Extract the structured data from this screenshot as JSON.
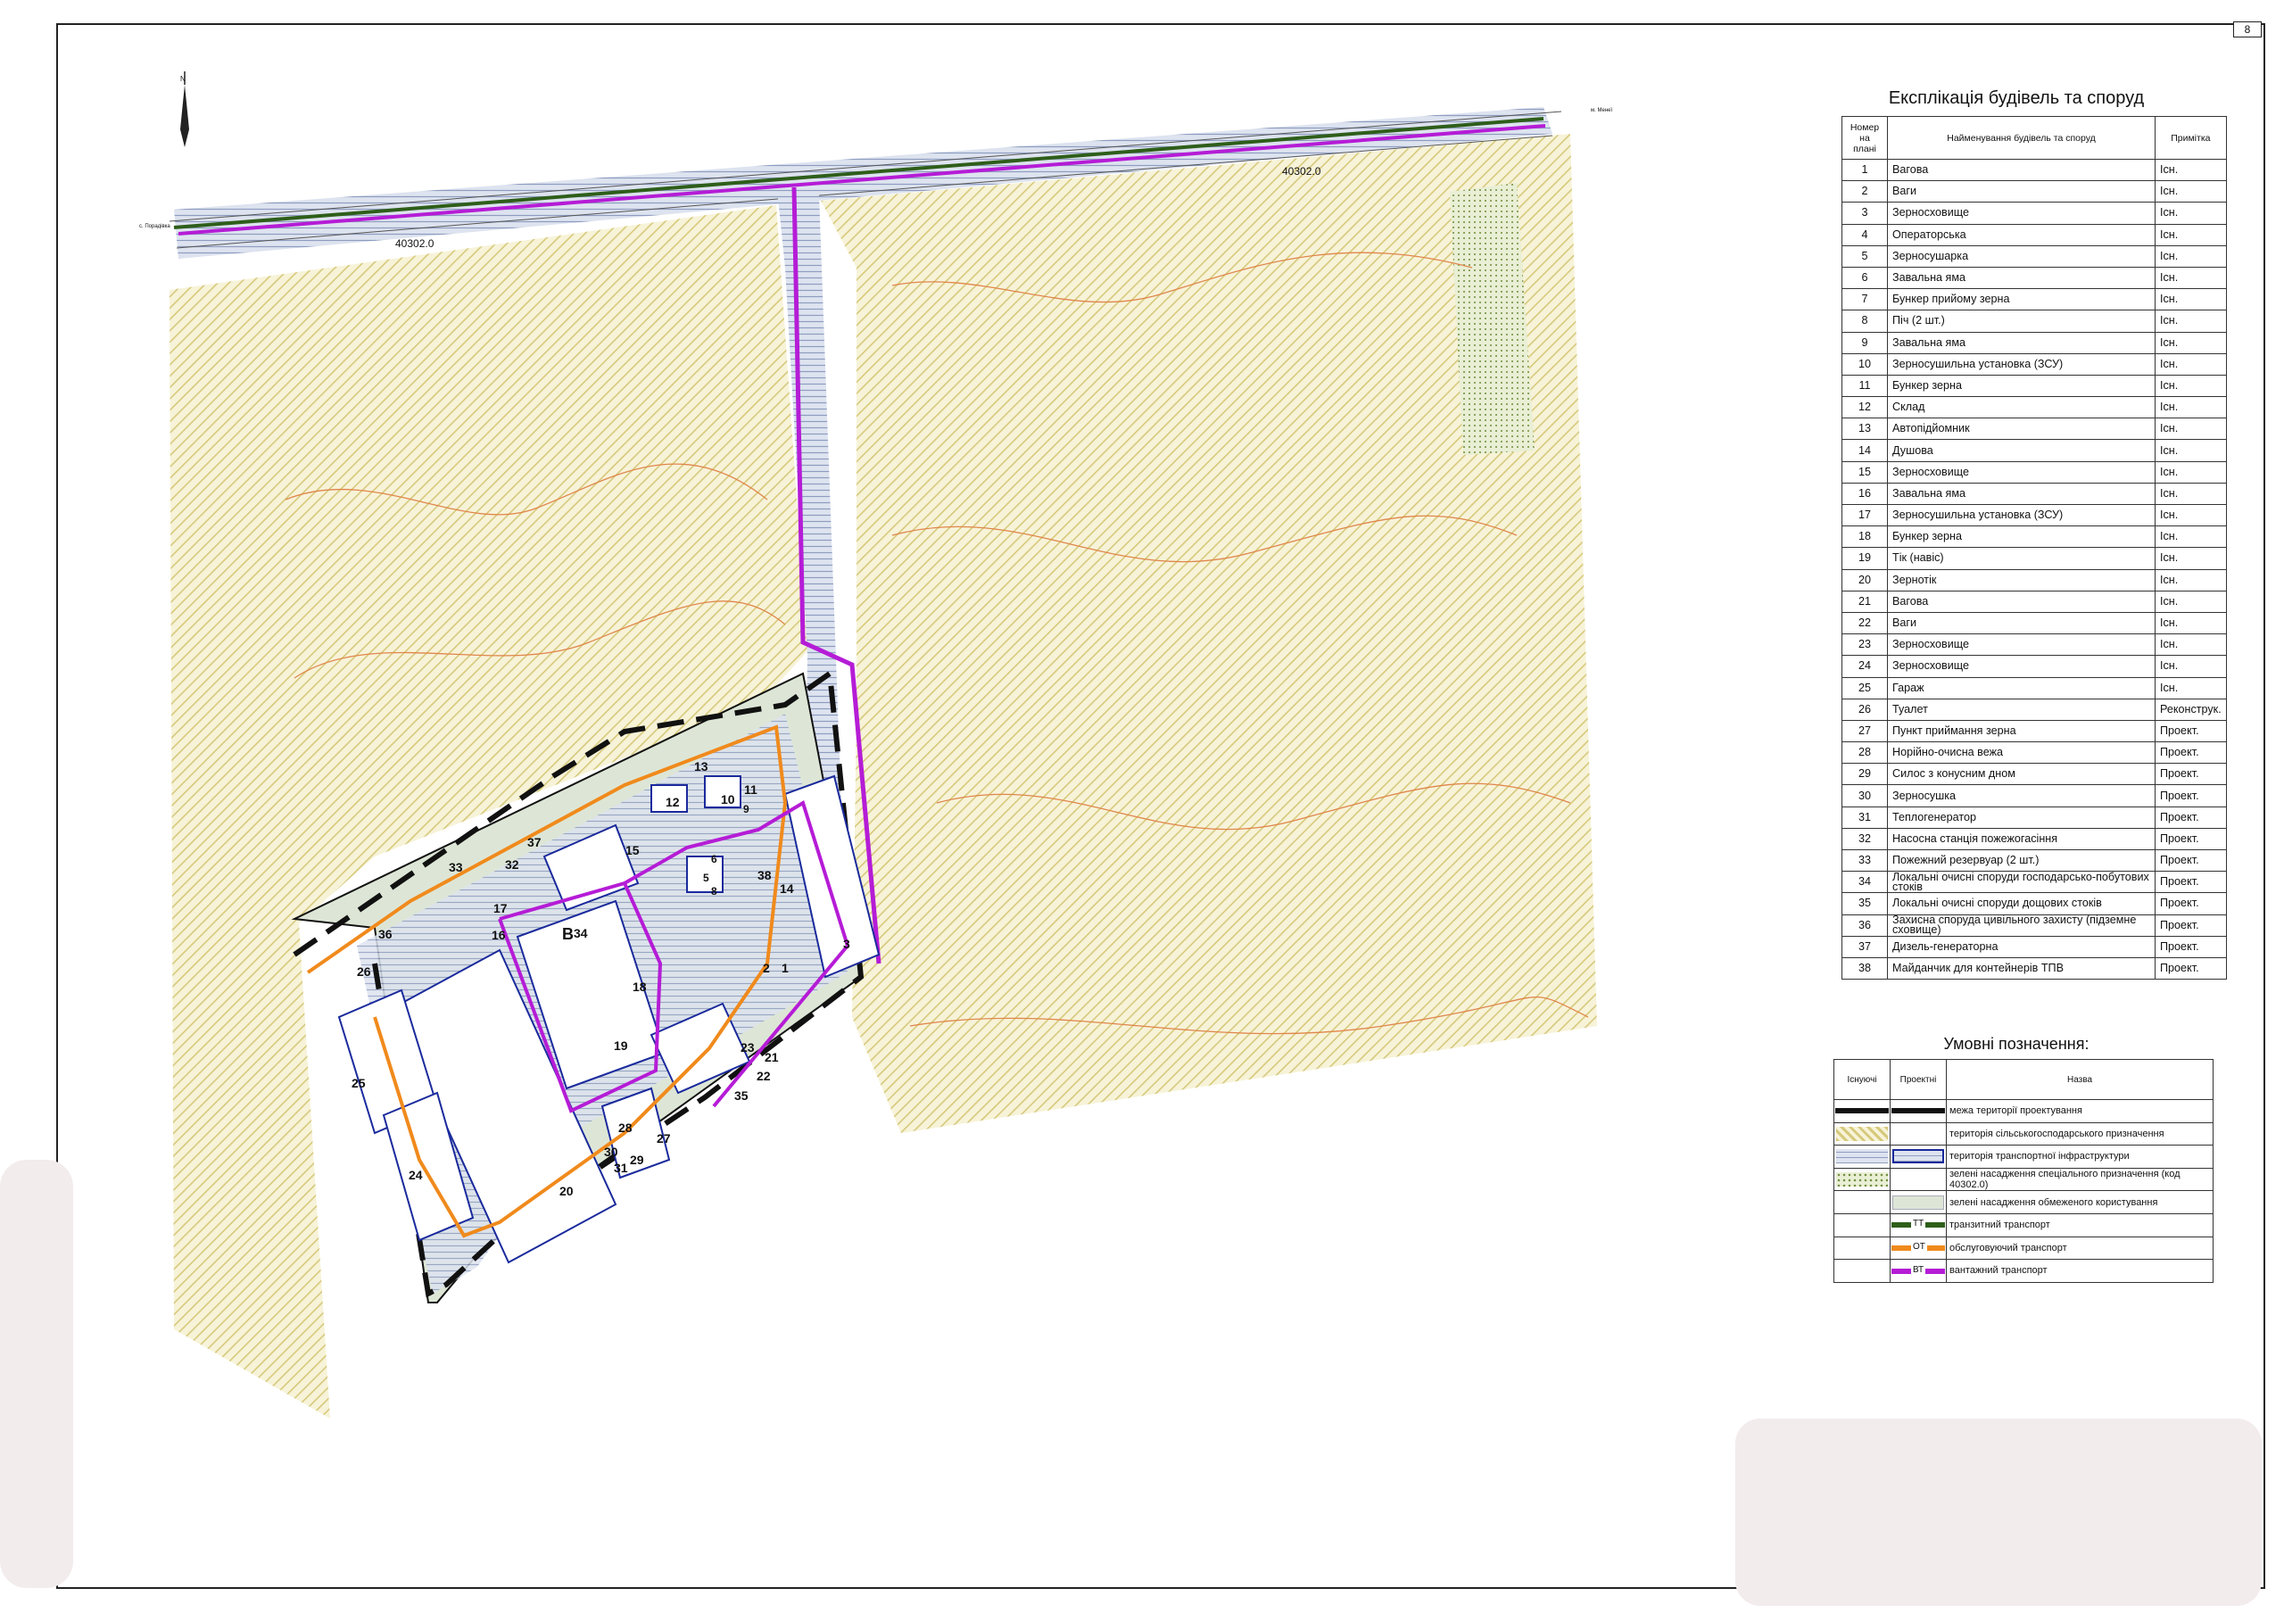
{
  "sheet_number": "8",
  "map": {
    "north_label": "N",
    "code_label_left": "40302.0",
    "code_label_right": "40302.0",
    "road_label_left": "с. Порадівка",
    "road_label_right": "м. Менеї",
    "plan_labels": [
      "1",
      "2",
      "3",
      "5",
      "6",
      "8",
      "9",
      "10",
      "11",
      "12",
      "13",
      "14",
      "15",
      "16",
      "17",
      "18",
      "19",
      "20",
      "21",
      "22",
      "23",
      "24",
      "25",
      "26",
      "27",
      "28",
      "29",
      "30",
      "31",
      "32",
      "33",
      "34",
      "35",
      "36",
      "37",
      "38",
      "B"
    ]
  },
  "explication": {
    "title": "Експлікація будівель та споруд",
    "headers": {
      "num": "Номер на плані",
      "name": "Найменування будівель та споруд",
      "note": "Примітка"
    },
    "rows": [
      {
        "num": "1",
        "name": "Вагова",
        "note": "Існ."
      },
      {
        "num": "2",
        "name": "Ваги",
        "note": "Існ."
      },
      {
        "num": "3",
        "name": "Зерносховище",
        "note": "Існ."
      },
      {
        "num": "4",
        "name": "Операторська",
        "note": "Існ."
      },
      {
        "num": "5",
        "name": "Зерносушарка",
        "note": "Існ."
      },
      {
        "num": "6",
        "name": "Завальна яма",
        "note": "Існ."
      },
      {
        "num": "7",
        "name": "Бункер прийому зерна",
        "note": "Існ."
      },
      {
        "num": "8",
        "name": "Піч (2 шт.)",
        "note": "Існ."
      },
      {
        "num": "9",
        "name": "Завальна яма",
        "note": "Існ."
      },
      {
        "num": "10",
        "name": "Зерносушильна установка (ЗСУ)",
        "note": "Існ."
      },
      {
        "num": "11",
        "name": "Бункер  зерна",
        "note": "Існ."
      },
      {
        "num": "12",
        "name": "Склад",
        "note": "Існ."
      },
      {
        "num": "13",
        "name": "Автопідйомник",
        "note": "Існ."
      },
      {
        "num": "14",
        "name": "Душова",
        "note": "Існ."
      },
      {
        "num": "15",
        "name": "Зерносховище",
        "note": "Існ."
      },
      {
        "num": "16",
        "name": "Завальна яма",
        "note": "Існ."
      },
      {
        "num": "17",
        "name": "Зерносушильна установка (ЗСУ)",
        "note": "Існ."
      },
      {
        "num": "18",
        "name": "Бункер  зерна",
        "note": "Існ."
      },
      {
        "num": "19",
        "name": "Тік (навіс)",
        "note": "Існ."
      },
      {
        "num": "20",
        "name": "Зернотік",
        "note": "Існ."
      },
      {
        "num": "21",
        "name": "Вагова",
        "note": "Існ."
      },
      {
        "num": "22",
        "name": "Ваги",
        "note": "Існ."
      },
      {
        "num": "23",
        "name": "Зерносховище",
        "note": "Існ."
      },
      {
        "num": "24",
        "name": "Зерносховище",
        "note": "Існ."
      },
      {
        "num": "25",
        "name": "Гараж",
        "note": "Існ."
      },
      {
        "num": "26",
        "name": "Туалет",
        "note": "Реконструк."
      },
      {
        "num": "27",
        "name": "Пункт приймання зерна",
        "note": "Проект."
      },
      {
        "num": "28",
        "name": "Норійно-очисна вежа",
        "note": "Проект."
      },
      {
        "num": "29",
        "name": "Силос з конусним дном",
        "note": "Проект."
      },
      {
        "num": "30",
        "name": "Зерносушка",
        "note": "Проект."
      },
      {
        "num": "31",
        "name": "Теплогенератор",
        "note": "Проект."
      },
      {
        "num": "32",
        "name": "Насосна станція пожежогасіння",
        "note": "Проект."
      },
      {
        "num": "33",
        "name": "Пожежний резервуар (2 шт.)",
        "note": "Проект."
      },
      {
        "num": "34",
        "name": "Локальні очисні споруди господарсько-побутових стоків",
        "note": "Проект."
      },
      {
        "num": "35",
        "name": "Локальні очисні споруди дощових стоків",
        "note": "Проект."
      },
      {
        "num": "36",
        "name": "Захисна споруда цивільного захисту (підземне сховище)",
        "note": "Проект."
      },
      {
        "num": "37",
        "name": "Дизель-генераторна",
        "note": "Проект."
      },
      {
        "num": "38",
        "name": "Майданчик для контейнерів ТПВ",
        "note": "Проект."
      }
    ]
  },
  "legend": {
    "title": "Умовні позначення:",
    "headers": {
      "existing": "Існуючі",
      "designed": "Проектні",
      "name": "Назва"
    },
    "items": [
      {
        "key": "boundary",
        "label": "межа території проектування"
      },
      {
        "key": "agri",
        "label": "територія сільськогосподарського призначення"
      },
      {
        "key": "transport",
        "label": "територія транспортної інфраструктури"
      },
      {
        "key": "special_green",
        "label": "зелені насадження спеціального призначення (код 40302.0)"
      },
      {
        "key": "limited_green",
        "label": "зелені насадження обмеженого користування"
      },
      {
        "key": "transit",
        "label": "транзитний транспорт",
        "tag": "ТТ"
      },
      {
        "key": "service",
        "label": "обслуговуючий транспорт",
        "tag": "ОТ"
      },
      {
        "key": "cargo",
        "label": "вантажний транспорт",
        "tag": "ВТ"
      }
    ]
  },
  "colors": {
    "agri_hatch": "#d9cf86",
    "agri_fill": "#f6f2d4",
    "transport_fill": "#c9d2e6",
    "green_fill": "#dde6d6",
    "boundary": "#111111",
    "transit": "#2e5e1a",
    "service": "#f08a1c",
    "cargo": "#b51cd6",
    "building_outline": "#1a2a9c",
    "contour": "#e0864a"
  }
}
